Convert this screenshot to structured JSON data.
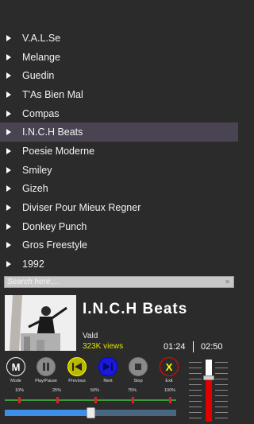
{
  "playlist": {
    "items": [
      {
        "label": "V.A.L.Se",
        "selected": false
      },
      {
        "label": "Melange",
        "selected": false
      },
      {
        "label": "Guedin",
        "selected": false
      },
      {
        "label": "T'As Bien Mal",
        "selected": false
      },
      {
        "label": "Compas",
        "selected": false
      },
      {
        "label": "I.N.C.H Beats",
        "selected": true
      },
      {
        "label": "Poesie Moderne",
        "selected": false
      },
      {
        "label": "Smiley",
        "selected": false
      },
      {
        "label": "Gizeh",
        "selected": false
      },
      {
        "label": "Diviser Pour Mieux Regner",
        "selected": false
      },
      {
        "label": "Donkey Punch",
        "selected": false
      },
      {
        "label": "Gros Freestyle",
        "selected": false
      },
      {
        "label": "1992",
        "selected": false
      }
    ]
  },
  "search": {
    "placeholder": "Search here....",
    "value": "",
    "clear_icon": "x-icon"
  },
  "now_playing": {
    "title": "I.N.C.H Beats",
    "artist": "Vald",
    "views": "323K views",
    "current_time": "01:24",
    "total_time": "02:50",
    "cover_icon": "album-cover-conductor-image"
  },
  "controls": [
    {
      "label": "Mode",
      "icon": "mode-m-icon"
    },
    {
      "label": "Play/Pause",
      "icon": "pause-icon"
    },
    {
      "label": "Previous",
      "icon": "previous-icon"
    },
    {
      "label": "Next",
      "icon": "next-icon"
    },
    {
      "label": "Stop",
      "icon": "stop-icon"
    },
    {
      "label": "Exit",
      "icon": "exit-x-icon"
    }
  ],
  "markers": {
    "labels": [
      "10%",
      "25%",
      "50%",
      "75%",
      "100%"
    ]
  },
  "progress": {
    "fraction": 0.5
  },
  "volume": {
    "fraction": 0.7
  },
  "colors": {
    "background": "#2b2b2b",
    "selected_row": "#4a4452",
    "views": "#e3e300",
    "previous_accent": "#ffff00",
    "next_accent": "#0000ff",
    "exit_accent": "#ff0000",
    "progress_fill": "#3c8ee6",
    "volume_fill": "#e00000"
  }
}
